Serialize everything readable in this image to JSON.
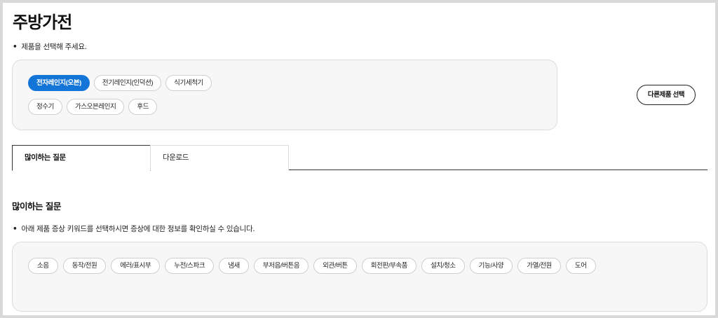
{
  "page": {
    "title": "주방가전",
    "select_note": "제품을 선택해 주세요.",
    "bullet": "•"
  },
  "products": {
    "items": [
      {
        "label": "전자레인지(오븐)",
        "active": true
      },
      {
        "label": "전기레인지(인덕션)",
        "active": false
      },
      {
        "label": "식기세척기",
        "active": false
      },
      {
        "label": "정수기",
        "active": false
      },
      {
        "label": "가스오븐레인지",
        "active": false
      },
      {
        "label": "후드",
        "active": false
      }
    ],
    "other_button": "다른제품 선택"
  },
  "tabs": [
    {
      "label": "많이하는 질문",
      "active": true
    },
    {
      "label": "다운로드",
      "active": false
    }
  ],
  "faq": {
    "title": "많이하는 질문",
    "note": "아래 제품 증상 키워드를 선택하시면 증상에 대한 정보를 확인하실 수 있습니다.",
    "keywords": [
      "소음",
      "동작/전원",
      "에러/표시부",
      "누전/스파크",
      "냄새",
      "부저음/버튼음",
      "외관/버튼",
      "회전판/부속품",
      "설치/청소",
      "기능/사양",
      "가열/전원",
      "도어"
    ]
  },
  "colors": {
    "accent": "#1475d8",
    "box_background": "#f7f7f7",
    "border": "#dcdcdc"
  }
}
